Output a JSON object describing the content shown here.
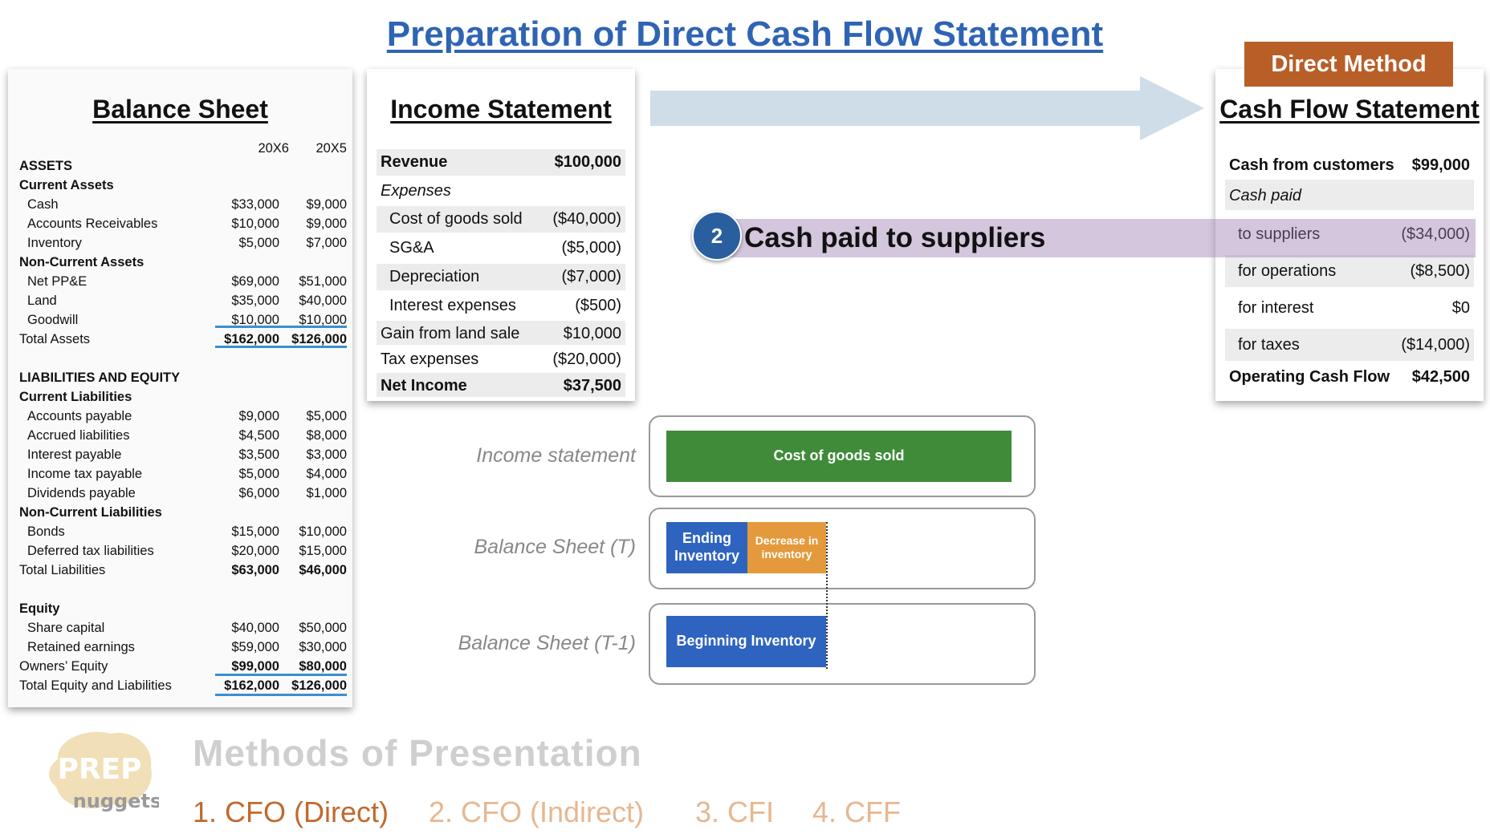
{
  "page_title": "Preparation of Direct Cash Flow Statement",
  "balance_sheet": {
    "title": "Balance Sheet",
    "columns": [
      "20X6",
      "20X5"
    ],
    "rows": [
      {
        "label": "ASSETS",
        "style": "head"
      },
      {
        "label": "Current Assets",
        "style": "head"
      },
      {
        "label": "Cash",
        "style": "item",
        "v1": "$33,000",
        "v2": "$9,000"
      },
      {
        "label": "Accounts Receivables",
        "style": "item",
        "v1": "$10,000",
        "v2": "$9,000"
      },
      {
        "label": "Inventory",
        "style": "item",
        "v1": "$5,000",
        "v2": "$7,000"
      },
      {
        "label": "Non-Current Assets",
        "style": "head"
      },
      {
        "label": "Net PP&E",
        "style": "item",
        "v1": "$69,000",
        "v2": "$51,000"
      },
      {
        "label": "Land",
        "style": "item",
        "v1": "$35,000",
        "v2": "$40,000"
      },
      {
        "label": "Goodwill",
        "style": "item",
        "v1": "$10,000",
        "v2": "$10,000"
      },
      {
        "label": "Total Assets",
        "style": "total",
        "v1": "$162,000",
        "v2": "$126,000"
      },
      {
        "label": "",
        "style": "blank"
      },
      {
        "label": "LIABILITIES AND EQUITY",
        "style": "head"
      },
      {
        "label": "Current Liabilities",
        "style": "head"
      },
      {
        "label": "Accounts payable",
        "style": "item",
        "v1": "$9,000",
        "v2": "$5,000"
      },
      {
        "label": "Accrued liabilities",
        "style": "item",
        "v1": "$4,500",
        "v2": "$8,000"
      },
      {
        "label": "Interest payable",
        "style": "item",
        "v1": "$3,500",
        "v2": "$3,000"
      },
      {
        "label": "Income tax payable",
        "style": "item",
        "v1": "$5,000",
        "v2": "$4,000"
      },
      {
        "label": "Dividends payable",
        "style": "item",
        "v1": "$6,000",
        "v2": "$1,000"
      },
      {
        "label": "Non-Current Liabilities",
        "style": "head"
      },
      {
        "label": "Bonds",
        "style": "item",
        "v1": "$15,000",
        "v2": "$10,000"
      },
      {
        "label": "Deferred tax liabilities",
        "style": "item",
        "v1": "$20,000",
        "v2": "$15,000"
      },
      {
        "label": "Total Liabilities",
        "style": "total",
        "v1": "$63,000",
        "v2": "$46,000"
      },
      {
        "label": "",
        "style": "blank"
      },
      {
        "label": "Equity",
        "style": "head"
      },
      {
        "label": "Share capital",
        "style": "item",
        "v1": "$40,000",
        "v2": "$50,000"
      },
      {
        "label": "Retained earnings",
        "style": "item",
        "v1": "$59,000",
        "v2": "$30,000"
      },
      {
        "label": "Owners’ Equity",
        "style": "total",
        "v1": "$99,000",
        "v2": "$80,000"
      },
      {
        "label": "Total Equity and Liabilities",
        "style": "total",
        "v1": "$162,000",
        "v2": "$126,000"
      }
    ]
  },
  "income_statement": {
    "title": "Income Statement",
    "rows": [
      {
        "label": "Revenue",
        "value": "$100,000",
        "style": "bold",
        "shade": true
      },
      {
        "label": "Expenses",
        "value": "",
        "style": "ital",
        "shade": false
      },
      {
        "label": "Cost of goods sold",
        "value": "($40,000)",
        "style": "indent",
        "shade": true
      },
      {
        "label": "SG&A",
        "value": "($5,000)",
        "style": "indent",
        "shade": false
      },
      {
        "label": "Depreciation",
        "value": "($7,000)",
        "style": "indent",
        "shade": true
      },
      {
        "label": "Interest expenses",
        "value": "($500)",
        "style": "indent",
        "shade": false
      },
      {
        "label": "Gain from land sale",
        "value": "$10,000",
        "style": "",
        "shade": true
      },
      {
        "label": "Tax expenses",
        "value": "($20,000)",
        "style": "",
        "shade": false
      },
      {
        "label": "Net Income",
        "value": "$37,500",
        "style": "bold",
        "shade": true
      }
    ]
  },
  "cash_flow_statement": {
    "badge": "Direct Method",
    "title": "Cash Flow Statement",
    "rows": [
      {
        "label": "Cash from customers",
        "value": "$99,000",
        "style": "bold",
        "shade": false
      },
      {
        "label": "Cash paid",
        "value": "",
        "style": "ital",
        "shade": true
      },
      {
        "label": "to suppliers",
        "value": "($34,000)",
        "style": "indent",
        "shade": false
      },
      {
        "label": "for operations",
        "value": "($8,500)",
        "style": "indent",
        "shade": true
      },
      {
        "label": "for interest",
        "value": "$0",
        "style": "indent",
        "shade": false
      },
      {
        "label": "for taxes",
        "value": "($14,000)",
        "style": "indent",
        "shade": true
      },
      {
        "label": "Operating Cash Flow",
        "value": "$42,500",
        "style": "bold",
        "shade": false
      }
    ]
  },
  "highlight": {
    "step": "2",
    "label": "Cash paid to suppliers"
  },
  "diagram": {
    "rows": [
      {
        "label": "Income statement"
      },
      {
        "label": "Balance Sheet (T)"
      },
      {
        "label": "Balance Sheet (T-1)"
      }
    ],
    "bars": {
      "cogs": "Cost of goods sold",
      "ending_inventory": "Ending Inventory",
      "decrease_inventory": "Decrease in inventory",
      "beginning_inventory": "Beginning Inventory"
    },
    "colors": {
      "green": "#3f8b3a",
      "blue": "#2e64c0",
      "orange": "#e49a3c"
    }
  },
  "footer": {
    "logo_top": "PREP",
    "logo_bottom": "nuggets",
    "methods_title": "Methods of Presentation",
    "methods": [
      {
        "label": "1. CFO (Direct)",
        "color": "#c06a2e"
      },
      {
        "label": "2. CFO (Indirect)",
        "color": "#e6b791"
      },
      {
        "label": "3. CFI",
        "color": "#e6b791"
      },
      {
        "label": "4. CFF",
        "color": "#e6b791"
      }
    ]
  }
}
